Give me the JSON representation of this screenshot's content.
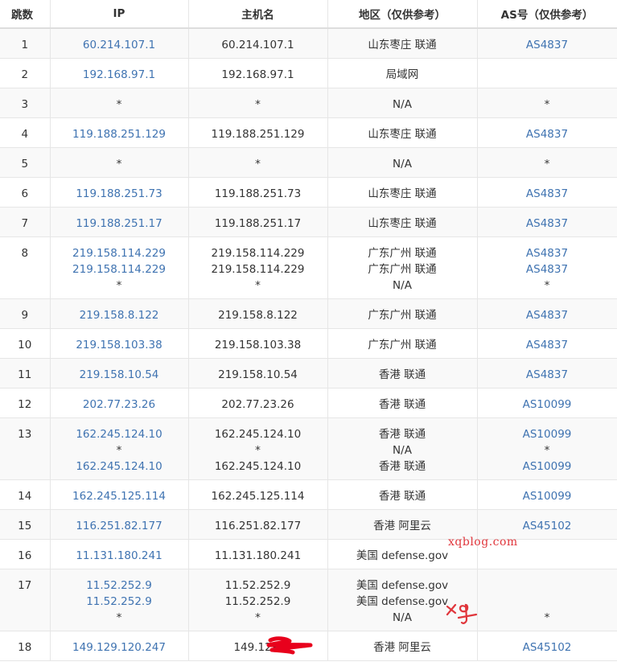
{
  "headers": [
    "跳数",
    "IP",
    "主机名",
    "地区（仅供参考）",
    "AS号（仅供参考）"
  ],
  "rows": [
    {
      "hop": "1",
      "ips": [
        "60.214.107.1"
      ],
      "hosts": [
        "60.214.107.1"
      ],
      "regions": [
        "山东枣庄 联通"
      ],
      "asns": [
        "AS4837"
      ]
    },
    {
      "hop": "2",
      "ips": [
        "192.168.97.1"
      ],
      "hosts": [
        "192.168.97.1"
      ],
      "regions": [
        "局域网"
      ],
      "asns": [
        ""
      ]
    },
    {
      "hop": "3",
      "ips": [
        "*"
      ],
      "hosts": [
        "*"
      ],
      "regions": [
        "N/A"
      ],
      "asns": [
        "*"
      ]
    },
    {
      "hop": "4",
      "ips": [
        "119.188.251.129"
      ],
      "hosts": [
        "119.188.251.129"
      ],
      "regions": [
        "山东枣庄 联通"
      ],
      "asns": [
        "AS4837"
      ]
    },
    {
      "hop": "5",
      "ips": [
        "*"
      ],
      "hosts": [
        "*"
      ],
      "regions": [
        "N/A"
      ],
      "asns": [
        "*"
      ]
    },
    {
      "hop": "6",
      "ips": [
        "119.188.251.73"
      ],
      "hosts": [
        "119.188.251.73"
      ],
      "regions": [
        "山东枣庄 联通"
      ],
      "asns": [
        "AS4837"
      ]
    },
    {
      "hop": "7",
      "ips": [
        "119.188.251.17"
      ],
      "hosts": [
        "119.188.251.17"
      ],
      "regions": [
        "山东枣庄 联通"
      ],
      "asns": [
        "AS4837"
      ]
    },
    {
      "hop": "8",
      "ips": [
        "219.158.114.229",
        "219.158.114.229",
        "*"
      ],
      "hosts": [
        "219.158.114.229",
        "219.158.114.229",
        "*"
      ],
      "regions": [
        "广东广州 联通",
        "广东广州 联通",
        "N/A"
      ],
      "asns": [
        "AS4837",
        "AS4837",
        "*"
      ]
    },
    {
      "hop": "9",
      "ips": [
        "219.158.8.122"
      ],
      "hosts": [
        "219.158.8.122"
      ],
      "regions": [
        "广东广州 联通"
      ],
      "asns": [
        "AS4837"
      ]
    },
    {
      "hop": "10",
      "ips": [
        "219.158.103.38"
      ],
      "hosts": [
        "219.158.103.38"
      ],
      "regions": [
        "广东广州 联通"
      ],
      "asns": [
        "AS4837"
      ]
    },
    {
      "hop": "11",
      "ips": [
        "219.158.10.54"
      ],
      "hosts": [
        "219.158.10.54"
      ],
      "regions": [
        "香港 联通"
      ],
      "asns": [
        "AS4837"
      ]
    },
    {
      "hop": "12",
      "ips": [
        "202.77.23.26"
      ],
      "hosts": [
        "202.77.23.26"
      ],
      "regions": [
        "香港 联通"
      ],
      "asns": [
        "AS10099"
      ]
    },
    {
      "hop": "13",
      "ips": [
        "162.245.124.10",
        "*",
        "162.245.124.10"
      ],
      "hosts": [
        "162.245.124.10",
        "*",
        "162.245.124.10"
      ],
      "regions": [
        "香港 联通",
        "N/A",
        "香港 联通"
      ],
      "asns": [
        "AS10099",
        "*",
        "AS10099"
      ]
    },
    {
      "hop": "14",
      "ips": [
        "162.245.125.114"
      ],
      "hosts": [
        "162.245.125.114"
      ],
      "regions": [
        "香港 联通"
      ],
      "asns": [
        "AS10099"
      ]
    },
    {
      "hop": "15",
      "ips": [
        "116.251.82.177"
      ],
      "hosts": [
        "116.251.82.177"
      ],
      "regions": [
        "香港 阿里云"
      ],
      "asns": [
        "AS45102"
      ]
    },
    {
      "hop": "16",
      "ips": [
        "11.131.180.241"
      ],
      "hosts": [
        "11.131.180.241"
      ],
      "regions": [
        "美国 defense.gov"
      ],
      "asns": [
        ""
      ]
    },
    {
      "hop": "17",
      "ips": [
        "11.52.252.9",
        "11.52.252.9",
        "*"
      ],
      "hosts": [
        "11.52.252.9",
        "11.52.252.9",
        "*"
      ],
      "regions": [
        "美国 defense.gov",
        "美国 defense.gov",
        "N/A"
      ],
      "asns": [
        "",
        "",
        "*"
      ]
    },
    {
      "hop": "18",
      "ips": [
        "149.129.120.247"
      ],
      "hosts": [
        "149.129."
      ],
      "regions": [
        "香港 阿里云"
      ],
      "asns": [
        "AS45102"
      ]
    }
  ],
  "watermark": "xqblog.com",
  "colors": {
    "link": "#3f73b1",
    "text": "#333333",
    "watermark": "#e0363c",
    "stripe": "#f9f9f9",
    "border": "#e6e6e6"
  }
}
